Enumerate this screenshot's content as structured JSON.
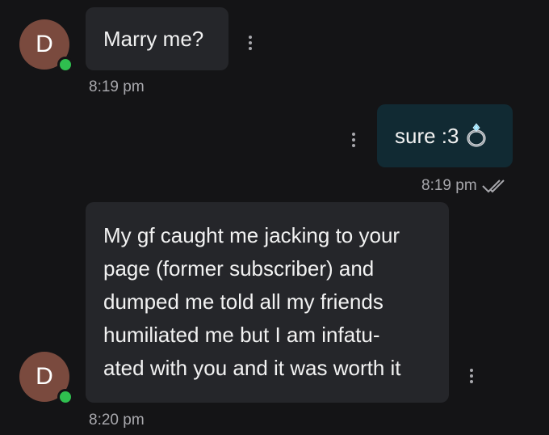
{
  "messages": [
    {
      "direction": "incoming",
      "avatar_letter": "D",
      "text": "Marry me?",
      "time": "8:19 pm"
    },
    {
      "direction": "outgoing",
      "text": "sure :3",
      "emoji": "ring-icon",
      "time": "8:19 pm",
      "status": "read"
    },
    {
      "direction": "incoming",
      "avatar_letter": "D",
      "lines": [
        "My gf caught me jacking to your",
        "page (former subscriber) and",
        "dumped me told all my friends",
        "humiliated me but I am infatu-",
        "ated with you and it was worth it"
      ],
      "time": "8:20 pm"
    }
  ],
  "colors": {
    "background": "#141416",
    "incoming_bubble": "#25262a",
    "outgoing_bubble": "#112a33",
    "avatar": "#7a4a3e",
    "online": "#2fbf4f",
    "timestamp": "#a8a8ad"
  }
}
